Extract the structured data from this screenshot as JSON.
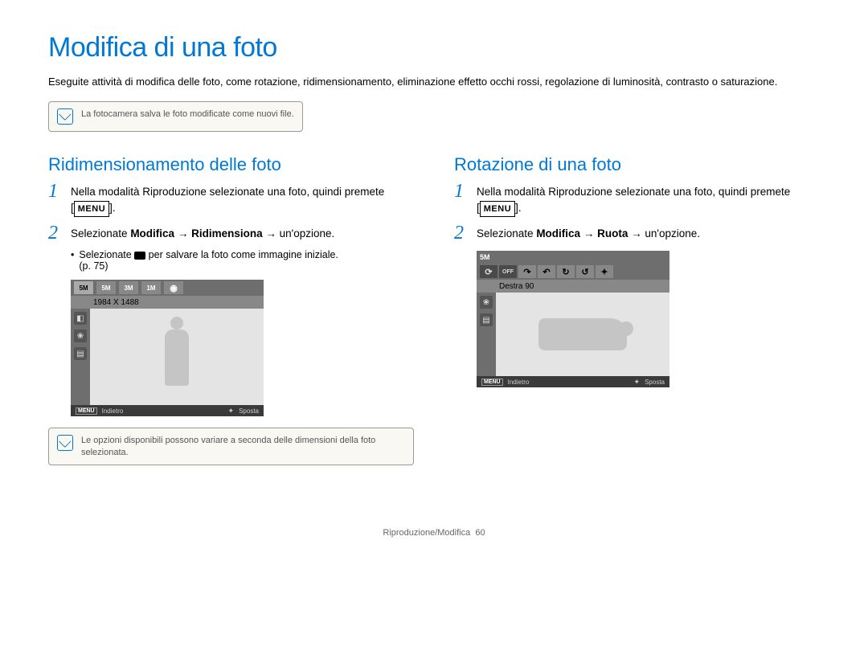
{
  "title": "Modifica di una foto",
  "intro": "Eseguite attività di modifica delle foto, come rotazione, ridimensionamento, eliminazione effetto occhi rossi, regolazione di luminosità, contrasto o saturazione.",
  "note1": "La fotocamera salva le foto modificate come nuovi file.",
  "left": {
    "heading": "Ridimensionamento delle foto",
    "step1": "Nella modalità Riproduzione selezionate una foto, quindi premete",
    "menu": "MENU",
    "step2_pre": "Selezionate ",
    "step2_b1": "Modifica",
    "step2_arrow": " → ",
    "step2_b2": "Ridimensiona",
    "step2_post": " → un'opzione.",
    "bullet_pre": "Selezionate ",
    "bullet_post": " per salvare la foto come immagine iniziale.",
    "bullet_ref": "(p. 75)",
    "screen": {
      "topIcons": [
        "5M",
        "5M",
        "3M",
        "1M"
      ],
      "subLabel": "1984 X 1488",
      "bottom_back": "Indietro",
      "bottom_move": "Sposta",
      "bottom_menu": "MENU"
    },
    "note2": "Le opzioni disponibili possono variare a seconda delle dimensioni della foto selezionata."
  },
  "right": {
    "heading": "Rotazione di una foto",
    "step1": "Nella modalità Riproduzione selezionate una foto, quindi premete",
    "menu": "MENU",
    "step2_pre": "Selezionate ",
    "step2_b1": "Modifica",
    "step2_arrow": " → ",
    "step2_b2": "Ruota",
    "step2_post": " → un'opzione.",
    "screen": {
      "topLabel": "5M",
      "rotIcons": [
        "⟳",
        "OFF",
        "↷",
        "↶",
        "↻",
        "↺",
        "✦"
      ],
      "subLabel": "Destra 90",
      "bottom_back": "Indietro",
      "bottom_move": "Sposta",
      "bottom_menu": "MENU"
    }
  },
  "footer": {
    "section": "Riproduzione/Modifica",
    "page": "60"
  }
}
